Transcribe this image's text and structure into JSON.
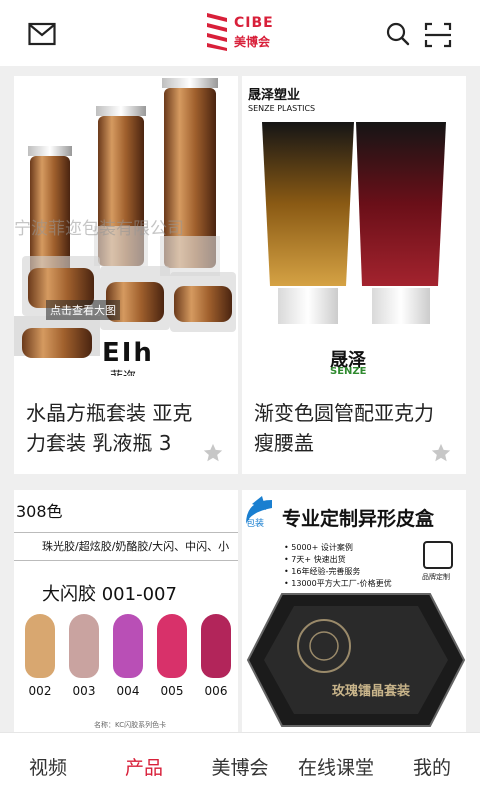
{
  "header": {
    "logo_en": "CIBE",
    "logo_cn": "美博会",
    "icons": {
      "left": "mail-icon",
      "search": "search-icon",
      "scan": "scan-icon"
    },
    "brand_color": "#d8203a"
  },
  "cards": [
    {
      "title": "水晶方瓶套装 亚克力套装 乳液瓶 3",
      "overlay_button": "点击查看大图",
      "brand_mark": "EIh",
      "brand_cn": "菲迩",
      "watermark": "宁波菲迩包装有限公司"
    },
    {
      "title": "渐变色圆管配亚克力瘦腰盖",
      "company_cn": "晟泽塑业",
      "company_en": "SENZE PLASTICS",
      "brand_cn": "晟泽",
      "brand_en": "SENZE"
    },
    {
      "title": "",
      "heading": "308色",
      "subheading": "珠光胶/超炫胶/奶酪胶/大闪、中闪、小",
      "series": "大闪胶 001-007",
      "swatches": [
        "002",
        "003",
        "004",
        "005",
        "006"
      ],
      "swatch_colors": [
        "#d8a770",
        "#c9a3a0",
        "#b94fb6",
        "#d8316a",
        "#b2255a"
      ],
      "footnote": "名称：KC闪胶系列色卡"
    },
    {
      "title": "",
      "tag": "包装",
      "headline": "专业定制异形皮盒",
      "bullets": [
        "5000+ 设计案例",
        "7天+ 快速出货",
        "16年经验-完善服务",
        "13000平方大工厂-价格更优"
      ],
      "badge": "品牌定制",
      "box_label": "玫瑰镭晶套装"
    }
  ],
  "nav": {
    "tabs": [
      "视频",
      "产品",
      "美博会",
      "在线课堂",
      "我的"
    ],
    "active_index": 1
  }
}
